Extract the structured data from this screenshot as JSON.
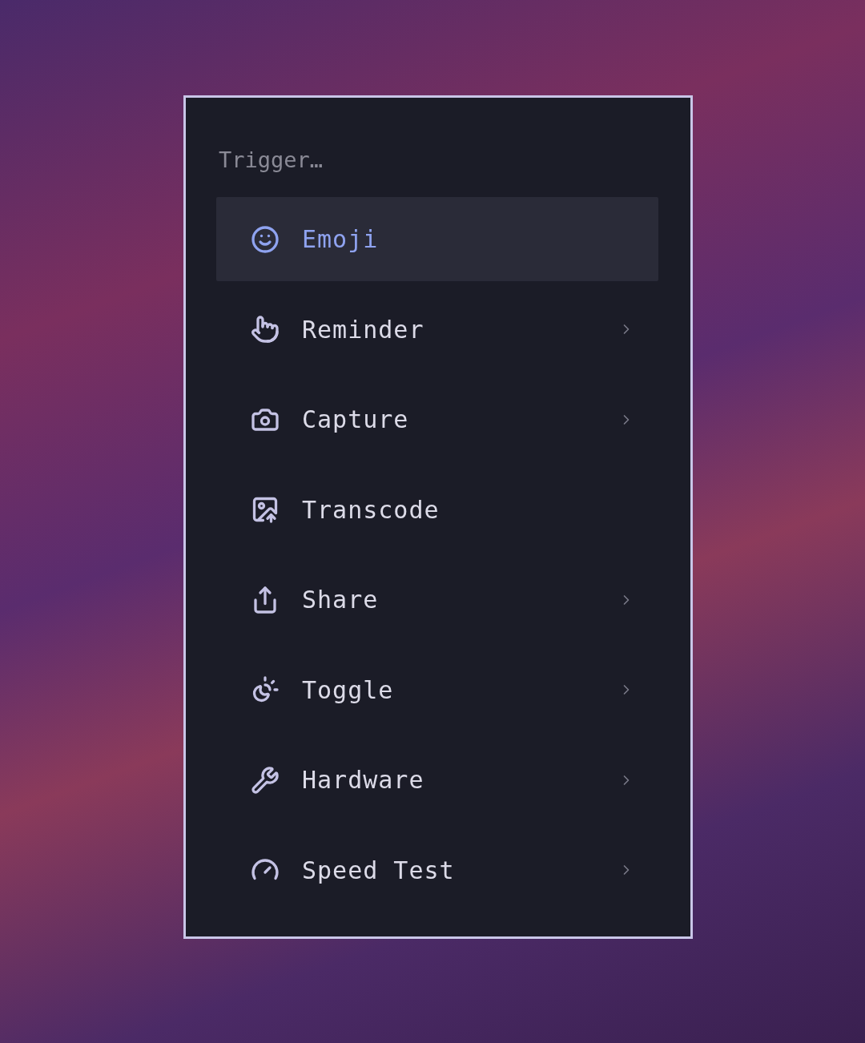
{
  "search": {
    "placeholder": "Trigger…"
  },
  "items": [
    {
      "label": "Emoji",
      "selected": true,
      "submenu": false
    },
    {
      "label": "Reminder",
      "selected": false,
      "submenu": true
    },
    {
      "label": "Capture",
      "selected": false,
      "submenu": true
    },
    {
      "label": "Transcode",
      "selected": false,
      "submenu": false
    },
    {
      "label": "Share",
      "selected": false,
      "submenu": true
    },
    {
      "label": "Toggle",
      "selected": false,
      "submenu": true
    },
    {
      "label": "Hardware",
      "selected": false,
      "submenu": true
    },
    {
      "label": "Speed Test",
      "selected": false,
      "submenu": true
    }
  ]
}
